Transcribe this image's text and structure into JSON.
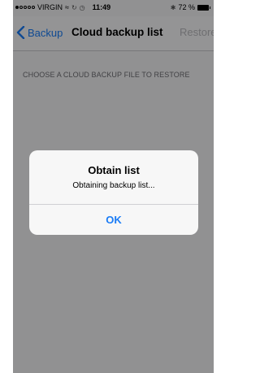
{
  "status_bar": {
    "carrier": "VIRGIN",
    "time": "11:49",
    "battery": "72 %"
  },
  "nav": {
    "back_label": "Backup",
    "title": "Cloud backup list",
    "restore_label": "Restore"
  },
  "list": {
    "section_header": "CHOOSE A CLOUD BACKUP FILE TO RESTORE"
  },
  "alert": {
    "title": "Obtain list",
    "message": "Obtaining backup list...",
    "ok_label": "OK"
  },
  "colors": {
    "accent": "#1a7cf6",
    "disabled": "#b8b8bc"
  }
}
